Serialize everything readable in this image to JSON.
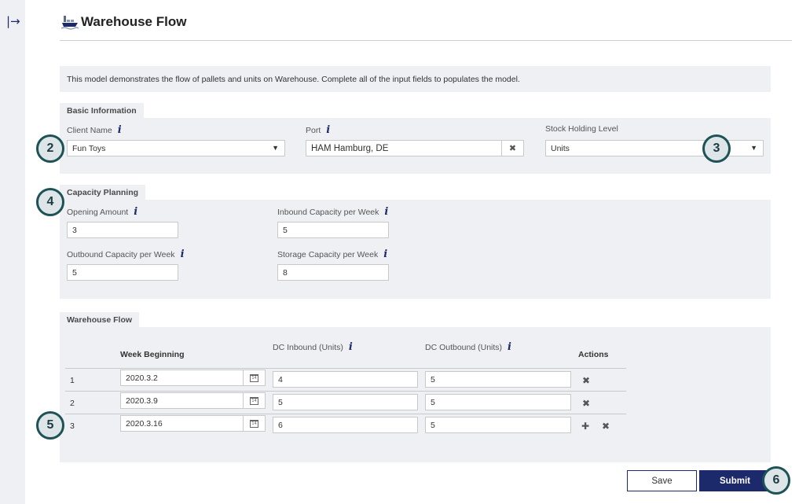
{
  "header": {
    "title": "Warehouse Flow",
    "expand_icon": "|→"
  },
  "intro": {
    "text": "This model demonstrates the flow of pallets and units on Warehouse. Complete all of the input fields to populates the model."
  },
  "basic_info": {
    "section_title": "Basic Information",
    "client_name": {
      "label": "Client Name",
      "value": "Fun Toys"
    },
    "port": {
      "label": "Port",
      "value": "HAM Hamburg, DE"
    },
    "stock_holding": {
      "label": "Stock Holding Level",
      "value": "Units"
    }
  },
  "capacity": {
    "section_title": "Capacity Planning",
    "opening_amount": {
      "label": "Opening Amount",
      "value": "3"
    },
    "inbound_capacity": {
      "label": "Inbound Capacity per Week",
      "value": "5"
    },
    "outbound_capacity": {
      "label": "Outbound Capacity per Week",
      "value": "5"
    },
    "storage_capacity": {
      "label": "Storage Capacity per Week",
      "value": "8"
    }
  },
  "flow": {
    "section_title": "Warehouse Flow",
    "columns": {
      "week": "Week Beginning",
      "inbound": "DC Inbound (Units)",
      "outbound": "DC Outbound (Units)",
      "actions": "Actions"
    },
    "calendar_glyph": "14",
    "rows": [
      {
        "num": "1",
        "week": "2020.3.2",
        "inbound": "4",
        "outbound": "5"
      },
      {
        "num": "2",
        "week": "2020.3.9",
        "inbound": "5",
        "outbound": "5"
      },
      {
        "num": "3",
        "week": "2020.3.16",
        "inbound": "6",
        "outbound": "5"
      }
    ]
  },
  "glyphs": {
    "caret": "▼",
    "clear": "✖",
    "add": "✚",
    "remove": "✖",
    "info": "i"
  },
  "buttons": {
    "save": "Save",
    "submit": "Submit"
  },
  "markers": [
    "2",
    "3",
    "4",
    "5",
    "6"
  ],
  "colors": {
    "navy": "#1c2a6b",
    "panel": "#eef0f3",
    "marker_ring": "#1d5257"
  }
}
